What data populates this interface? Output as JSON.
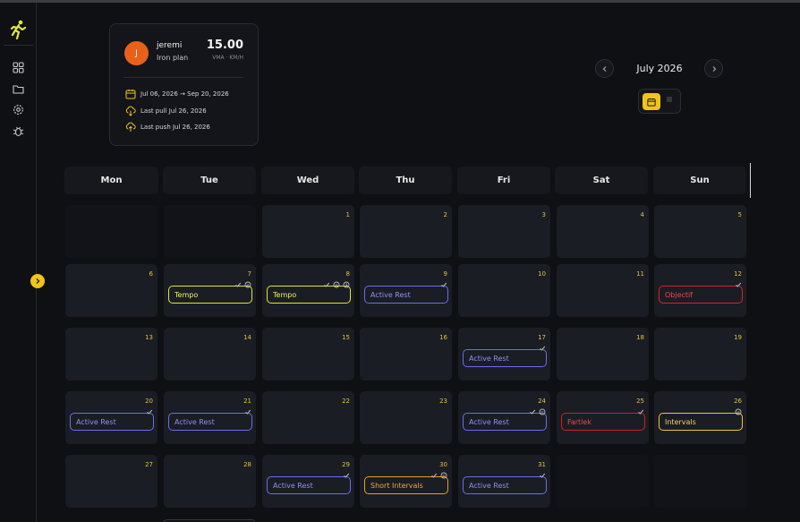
{
  "sidebar": {
    "logo": "runner-icon",
    "items": [
      {
        "icon": "dashboard-icon"
      },
      {
        "icon": "folder-icon"
      },
      {
        "icon": "settings-icon"
      },
      {
        "icon": "bug-icon"
      }
    ],
    "expand_icon": "chevron-right-icon"
  },
  "profile": {
    "initial": "J",
    "name": "jeremi",
    "plan": "Iron plan",
    "vma_value": "15.00",
    "vma_label": "VMA · KM/H",
    "date_range": "Jul 06, 2026 → Sep 20, 2026",
    "last_pull": "Last pull Jul 26, 2026",
    "last_push": "Last push Jul 26, 2026",
    "accent_color": "#e8601a"
  },
  "calendar": {
    "month_title": "July 2026",
    "prev_icon": "chevron-left-icon",
    "next_icon": "chevron-right-icon",
    "view_active": "calendar-view-icon",
    "view_inactive": "list-view-icon",
    "weekdays": [
      "Mon",
      "Tue",
      "Wed",
      "Thu",
      "Fri",
      "Sat",
      "Sun"
    ],
    "weeks": [
      [
        {
          "day": "",
          "empty": true
        },
        {
          "day": "",
          "empty": true
        },
        {
          "day": "1"
        },
        {
          "day": "2"
        },
        {
          "day": "3"
        },
        {
          "day": "4"
        },
        {
          "day": "5"
        }
      ],
      [
        {
          "day": "6"
        },
        {
          "day": "7",
          "workout": "Tempo",
          "kind": "tempo",
          "icons": [
            "check",
            "comment"
          ]
        },
        {
          "day": "8",
          "workout": "Tempo",
          "kind": "tempo",
          "icons": [
            "check",
            "comment",
            "clock"
          ]
        },
        {
          "day": "9",
          "workout": "Active Rest",
          "kind": "rest",
          "icons": [
            "check"
          ]
        },
        {
          "day": "10"
        },
        {
          "day": "11"
        },
        {
          "day": "12",
          "workout": "Objectif",
          "kind": "objectif",
          "icons": [
            "check"
          ]
        }
      ],
      [
        {
          "day": "13"
        },
        {
          "day": "14"
        },
        {
          "day": "15"
        },
        {
          "day": "16"
        },
        {
          "day": "17",
          "workout": "Active Rest",
          "kind": "rest",
          "icons": [
            "check"
          ]
        },
        {
          "day": "18"
        },
        {
          "day": "19"
        }
      ],
      [
        {
          "day": "20",
          "workout": "Active Rest",
          "kind": "rest",
          "icons": [
            "check"
          ]
        },
        {
          "day": "21",
          "workout": "Active Rest",
          "kind": "rest",
          "icons": [
            "check"
          ]
        },
        {
          "day": "22"
        },
        {
          "day": "23"
        },
        {
          "day": "24",
          "workout": "Active Rest",
          "kind": "rest",
          "icons": [
            "check",
            "comment"
          ]
        },
        {
          "day": "25",
          "workout": "Fartlek",
          "kind": "fartlek",
          "icons": [
            "check"
          ]
        },
        {
          "day": "26",
          "workout": "Intervals",
          "kind": "intervals",
          "icons": [
            "comment"
          ]
        }
      ],
      [
        {
          "day": "27"
        },
        {
          "day": "28"
        },
        {
          "day": "29",
          "workout": "Active Rest",
          "kind": "rest",
          "icons": [
            "check"
          ]
        },
        {
          "day": "30",
          "workout": "Short Intervals",
          "kind": "short",
          "icons": [
            "check",
            "comment"
          ]
        },
        {
          "day": "31",
          "workout": "Active Rest",
          "kind": "rest",
          "icons": [
            "check"
          ]
        },
        {
          "day": "",
          "empty": true
        },
        {
          "day": "",
          "empty": true
        }
      ]
    ]
  },
  "colors": {
    "accent": "#f0c419",
    "tempo": "#e2e43a",
    "active_rest": "#6c6cf0",
    "objectif": "#d6242a",
    "fartlek": "#c8242a",
    "intervals": "#f4c232",
    "short_intervals": "#f09a28"
  }
}
